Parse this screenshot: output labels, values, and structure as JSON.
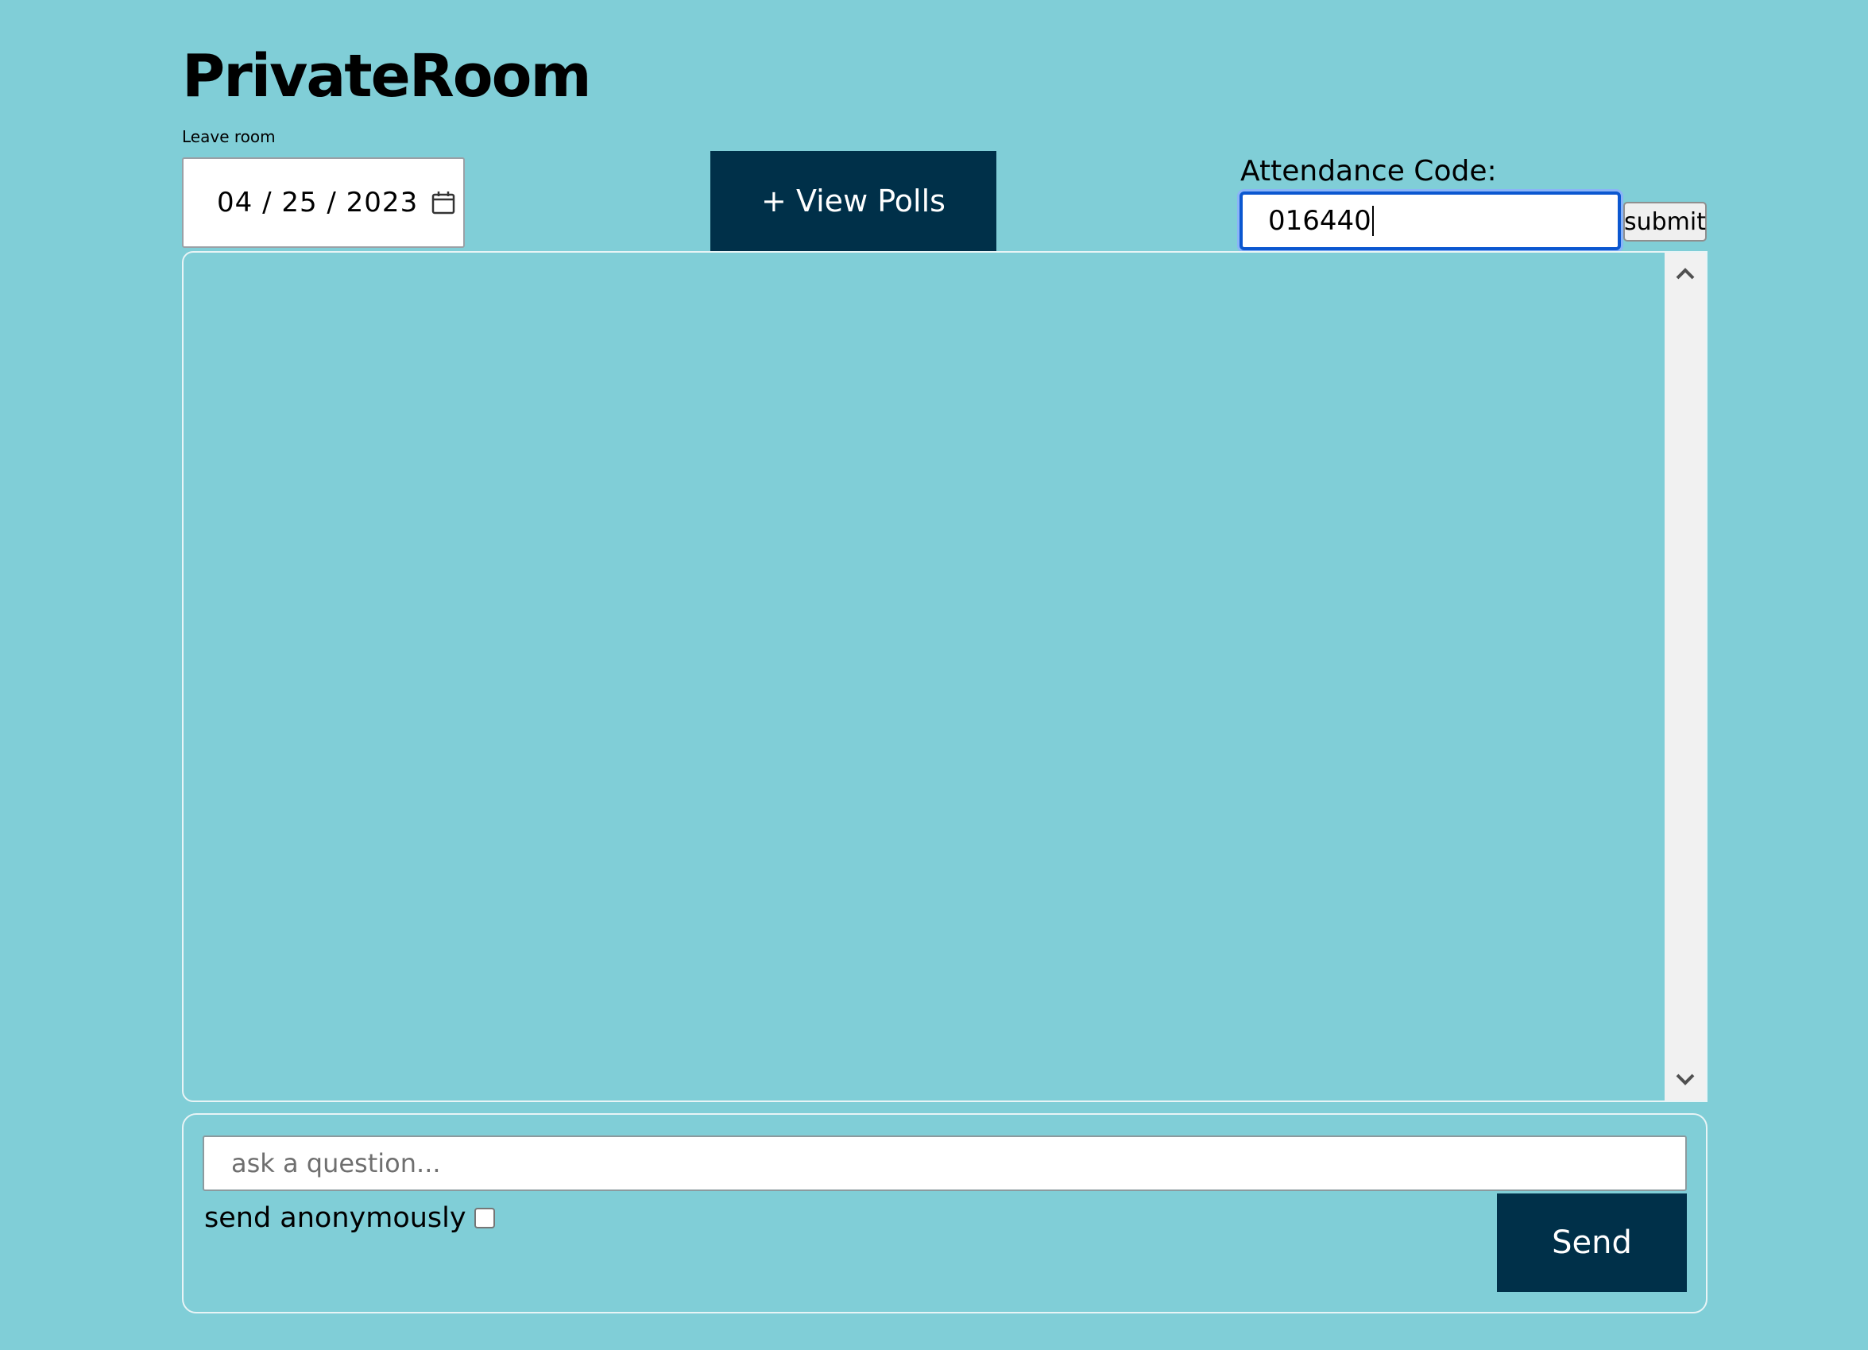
{
  "header": {
    "title": "PrivateRoom",
    "leave_label": "Leave room"
  },
  "date_picker": {
    "value": "04 / 25 / 2023",
    "icon": "calendar-icon"
  },
  "polls": {
    "button_label": "+ View Polls"
  },
  "attendance": {
    "label": "Attendance Code:",
    "value": "016440",
    "submit_label": "submit"
  },
  "messages": {
    "items": [],
    "scroll_up_icon": "chevron-up-icon",
    "scroll_down_icon": "chevron-down-icon"
  },
  "compose": {
    "placeholder": "ask a question...",
    "value": "",
    "anonymous_label": "send anonymously",
    "anonymous_checked": false,
    "send_label": "Send"
  },
  "colors": {
    "background": "#80CED7",
    "button_bg": "#003049",
    "button_text": "#FFFFFF",
    "focus_border": "#0B57D0"
  }
}
